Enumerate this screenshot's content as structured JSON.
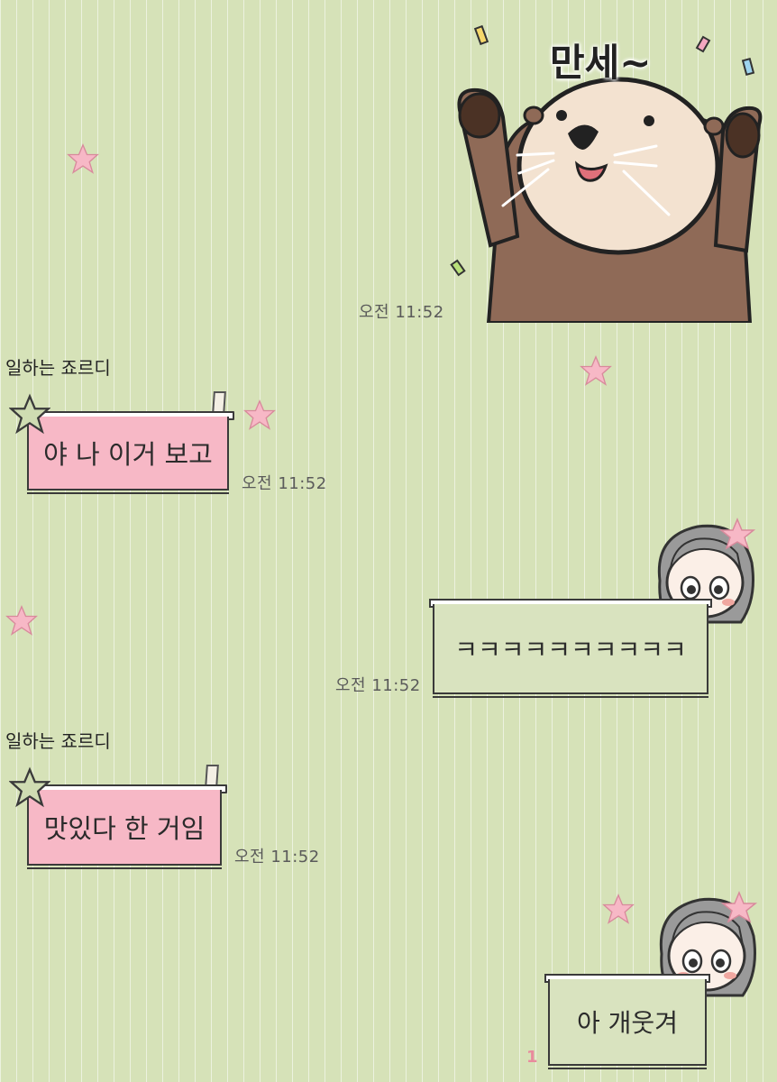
{
  "messages": [
    {
      "type": "sticker",
      "direction": "sent",
      "sticker_text": "만세~",
      "time": "오전 11:52"
    },
    {
      "type": "text",
      "direction": "received",
      "sender": "일하는 죠르디",
      "text": "야 나 이거 보고",
      "time": "오전 11:52"
    },
    {
      "type": "text",
      "direction": "sent",
      "text": "ㅋㅋㅋㅋㅋㅋㅋㅋㅋㅋ",
      "time": "오전 11:52"
    },
    {
      "type": "text",
      "direction": "received",
      "sender": "일하는 죠르디",
      "text": "맛있다 한 거임",
      "time": "오전 11:52"
    },
    {
      "type": "text",
      "direction": "sent",
      "text": "아 개웃겨",
      "unread": "1"
    }
  ],
  "colors": {
    "background": "#d6e2b8",
    "received_bubble": "#f7b8c6",
    "sent_bubble": "#d9e3bf",
    "unread_count": "#e88b9d",
    "star": "#f7b8c6"
  },
  "icons": [
    "pink-star-icon",
    "green-star-icon",
    "otter-sticker",
    "girl-avatar-decoration"
  ]
}
